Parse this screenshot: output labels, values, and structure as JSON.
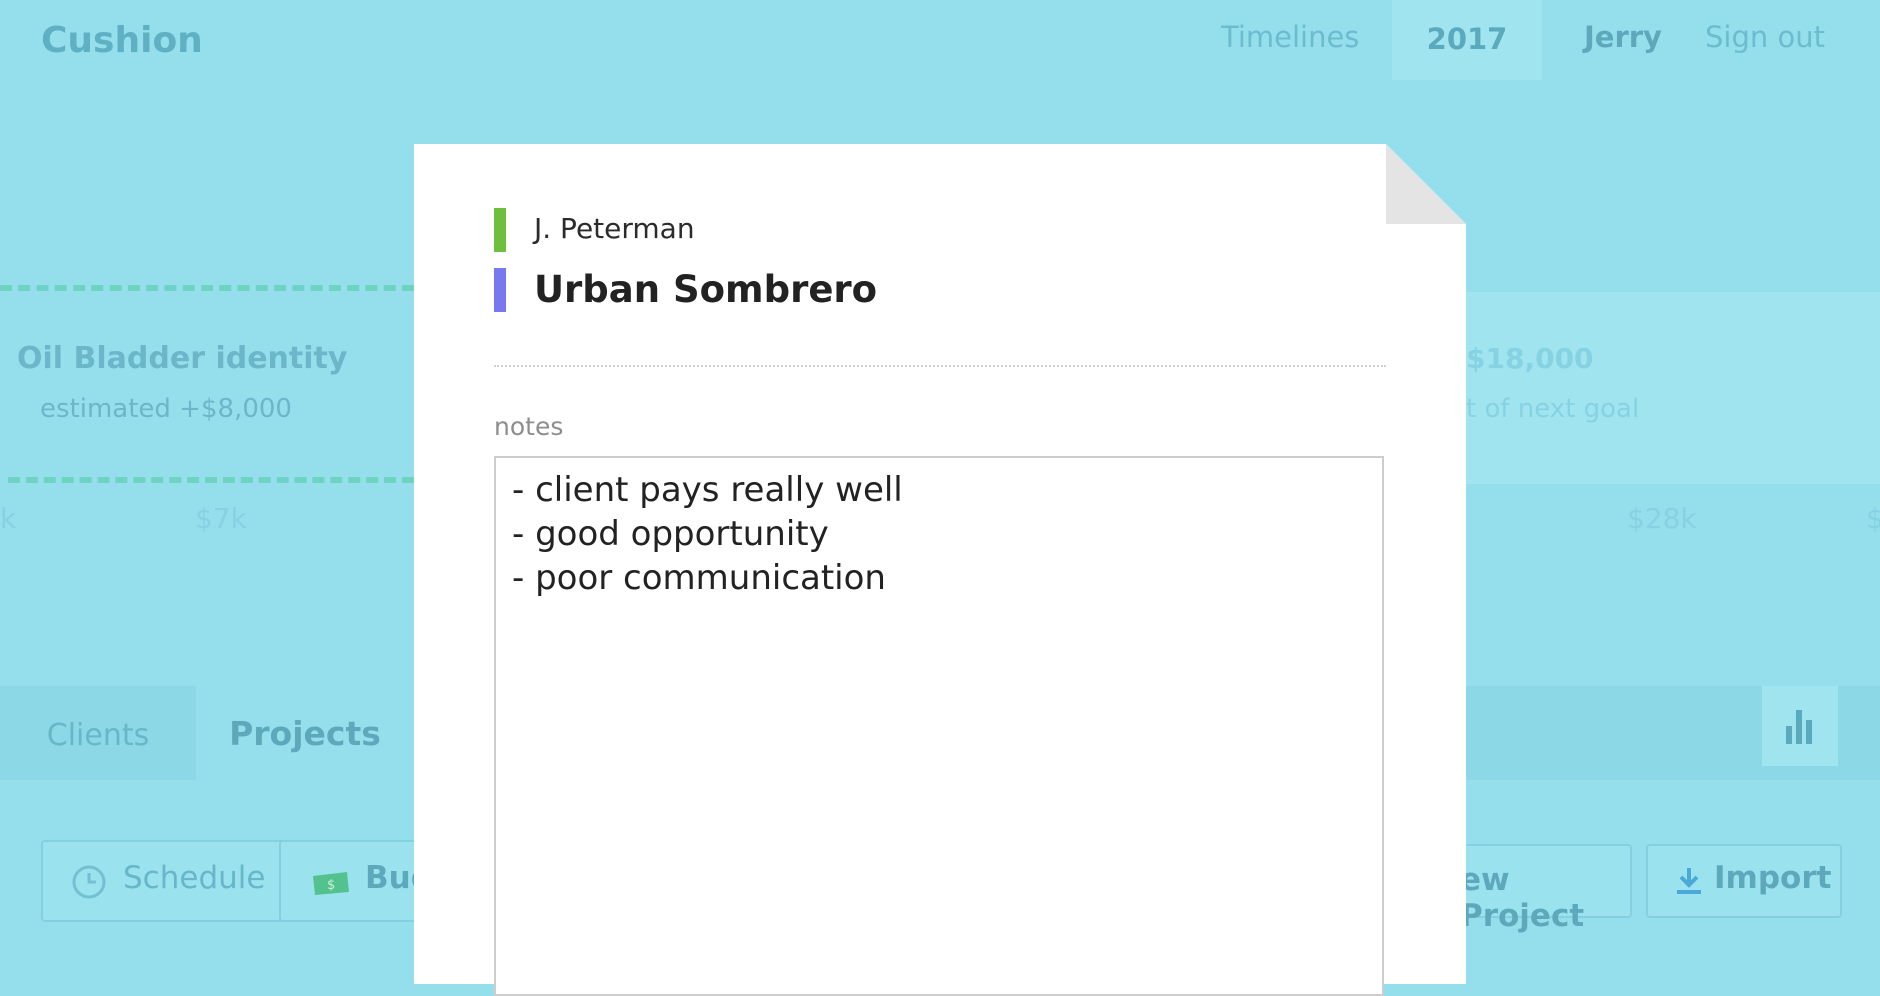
{
  "app": {
    "logo": "Cushion"
  },
  "nav": {
    "timelines": "Timelines",
    "year": "2017",
    "user": "Jerry",
    "signout": "Sign out"
  },
  "background": {
    "project_left": {
      "title": "Oil Bladder identity",
      "subtitle": "estimated +$8,000"
    },
    "project_right": {
      "amount": "$18,000",
      "subtitle": "t of next goal"
    },
    "axis": {
      "left_edge": "k",
      "mid": "$7k",
      "right": "$28k",
      "right_edge": "$"
    }
  },
  "tabs": {
    "clients": "Clients",
    "projects": "Projects"
  },
  "toolbar": {
    "schedule": "Schedule",
    "budget": "Bud",
    "new_project": "ew Project",
    "import": "Import"
  },
  "modal": {
    "client": "J. Peterman",
    "project": "Urban Sombrero",
    "notes_label": "notes",
    "notes_lines": [
      "- client pays really well",
      "- good opportunity",
      "- poor communication"
    ]
  },
  "colors": {
    "background": "#95dfed",
    "client_stripe": "#6fbf3f",
    "project_stripe": "#7a78ee",
    "dashed_line": "#6fd3c4"
  },
  "icons": {
    "schedule": "clock-icon",
    "budget": "money-icon",
    "import": "download-icon",
    "chart": "bar-chart-icon"
  }
}
